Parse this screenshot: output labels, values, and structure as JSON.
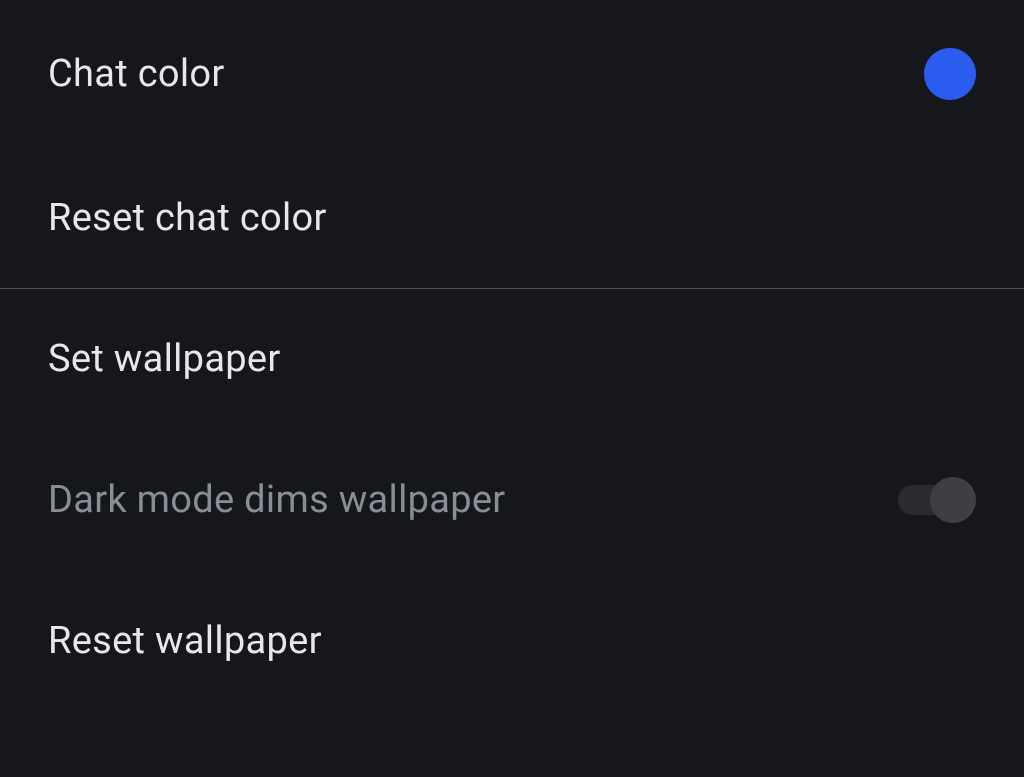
{
  "colors": {
    "chat_color_swatch": "#2b5cf0"
  },
  "items": {
    "chat_color": {
      "label": "Chat color"
    },
    "reset_chat_color": {
      "label": "Reset chat color"
    },
    "set_wallpaper": {
      "label": "Set wallpaper"
    },
    "dark_mode_dims": {
      "label": "Dark mode dims wallpaper",
      "enabled": false,
      "toggle_state": "on"
    },
    "reset_wallpaper": {
      "label": "Reset wallpaper"
    }
  }
}
